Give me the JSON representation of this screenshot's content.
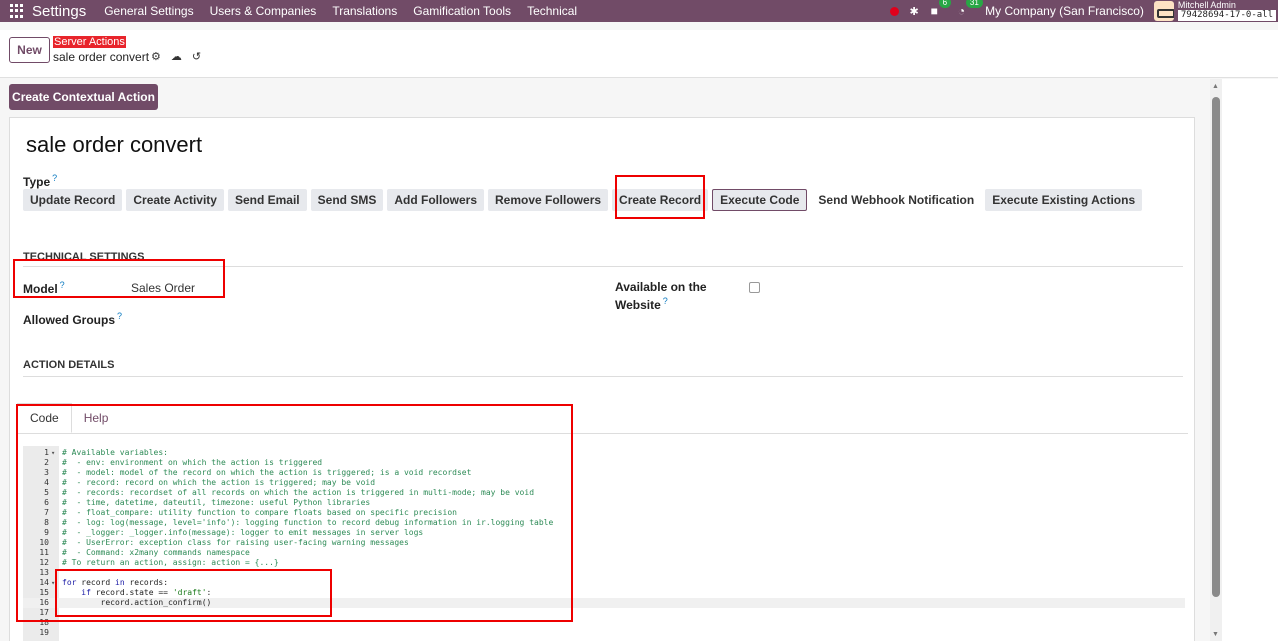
{
  "navbar": {
    "brand": "Settings",
    "menu": [
      "General Settings",
      "Users & Companies",
      "Translations",
      "Gamification Tools",
      "Technical"
    ],
    "chat_count": "6",
    "activity_count": "31",
    "company": "My Company (San Francisco)",
    "user": "Mitchell Admin",
    "database": "79428694-17-0-all"
  },
  "control": {
    "new_label": "New",
    "breadcrumb": "Server Actions",
    "record_name": "sale order convert"
  },
  "form": {
    "contextual_button": "Create Contextual Action",
    "title": "sale order convert",
    "type_label": "Type",
    "help_mark": "?",
    "types": [
      "Update Record",
      "Create Activity",
      "Send Email",
      "Send SMS",
      "Add Followers",
      "Remove Followers",
      "Create Record",
      "Execute Code",
      "Send Webhook Notification",
      "Execute Existing Actions"
    ],
    "active_type": "Execute Code",
    "technical_settings": "TECHNICAL SETTINGS",
    "model_label": "Model",
    "model_value": "Sales Order",
    "website_label_1": "Available on the",
    "website_label_2": "Website",
    "allowed_groups_label": "Allowed Groups",
    "action_details": "ACTION DETAILS",
    "tabs": [
      "Code",
      "Help"
    ]
  },
  "code_lines": [
    "# Available variables:",
    "#  - env: environment on which the action is triggered",
    "#  - model: model of the record on which the action is triggered; is a void recordset",
    "#  - record: record on which the action is triggered; may be void",
    "#  - records: recordset of all records on which the action is triggered in multi-mode; may be void",
    "#  - time, datetime, dateutil, timezone: useful Python libraries",
    "#  - float_compare: utility function to compare floats based on specific precision",
    "#  - log: log(message, level='info'): logging function to record debug information in ir.logging table",
    "#  - _logger: _logger.info(message): logger to emit messages in server logs",
    "#  - UserError: exception class for raising user-facing warning messages",
    "#  - Command: x2many commands namespace",
    "# To return an action, assign: action = {...}",
    "",
    "for record in records:",
    "    if record.state == 'draft':",
    "        record.action_confirm()",
    "",
    "",
    ""
  ]
}
